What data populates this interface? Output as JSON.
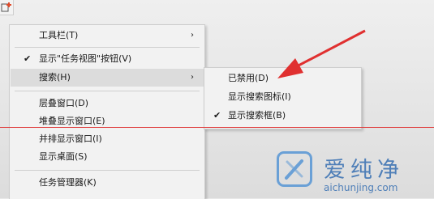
{
  "context_menu": {
    "items": [
      {
        "label": "工具栏(T)",
        "has_submenu": true,
        "checked": false
      },
      {
        "label": "显示\"任务视图\"按钮(V)",
        "has_submenu": false,
        "checked": true
      },
      {
        "label": "搜索(H)",
        "has_submenu": true,
        "checked": false,
        "highlighted": true
      },
      {
        "label": "层叠窗口(D)",
        "has_submenu": false,
        "checked": false
      },
      {
        "label": "堆叠显示窗口(E)",
        "has_submenu": false,
        "checked": false
      },
      {
        "label": "并排显示窗口(I)",
        "has_submenu": false,
        "checked": false
      },
      {
        "label": "显示桌面(S)",
        "has_submenu": false,
        "checked": false
      },
      {
        "label": "任务管理器(K)",
        "has_submenu": false,
        "checked": false
      }
    ],
    "arrow_glyph": "›",
    "check_glyph": "✔"
  },
  "search_submenu": {
    "items": [
      {
        "label": "已禁用(D)",
        "checked": false
      },
      {
        "label": "显示搜索图标(I)",
        "checked": false
      },
      {
        "label": "显示搜索框(B)",
        "checked": true
      }
    ]
  },
  "watermark": {
    "title": "爱纯净",
    "url": "aichunjing.com"
  },
  "colors": {
    "annotation_red": "#e03030",
    "watermark_blue": "#4f7fb8"
  }
}
